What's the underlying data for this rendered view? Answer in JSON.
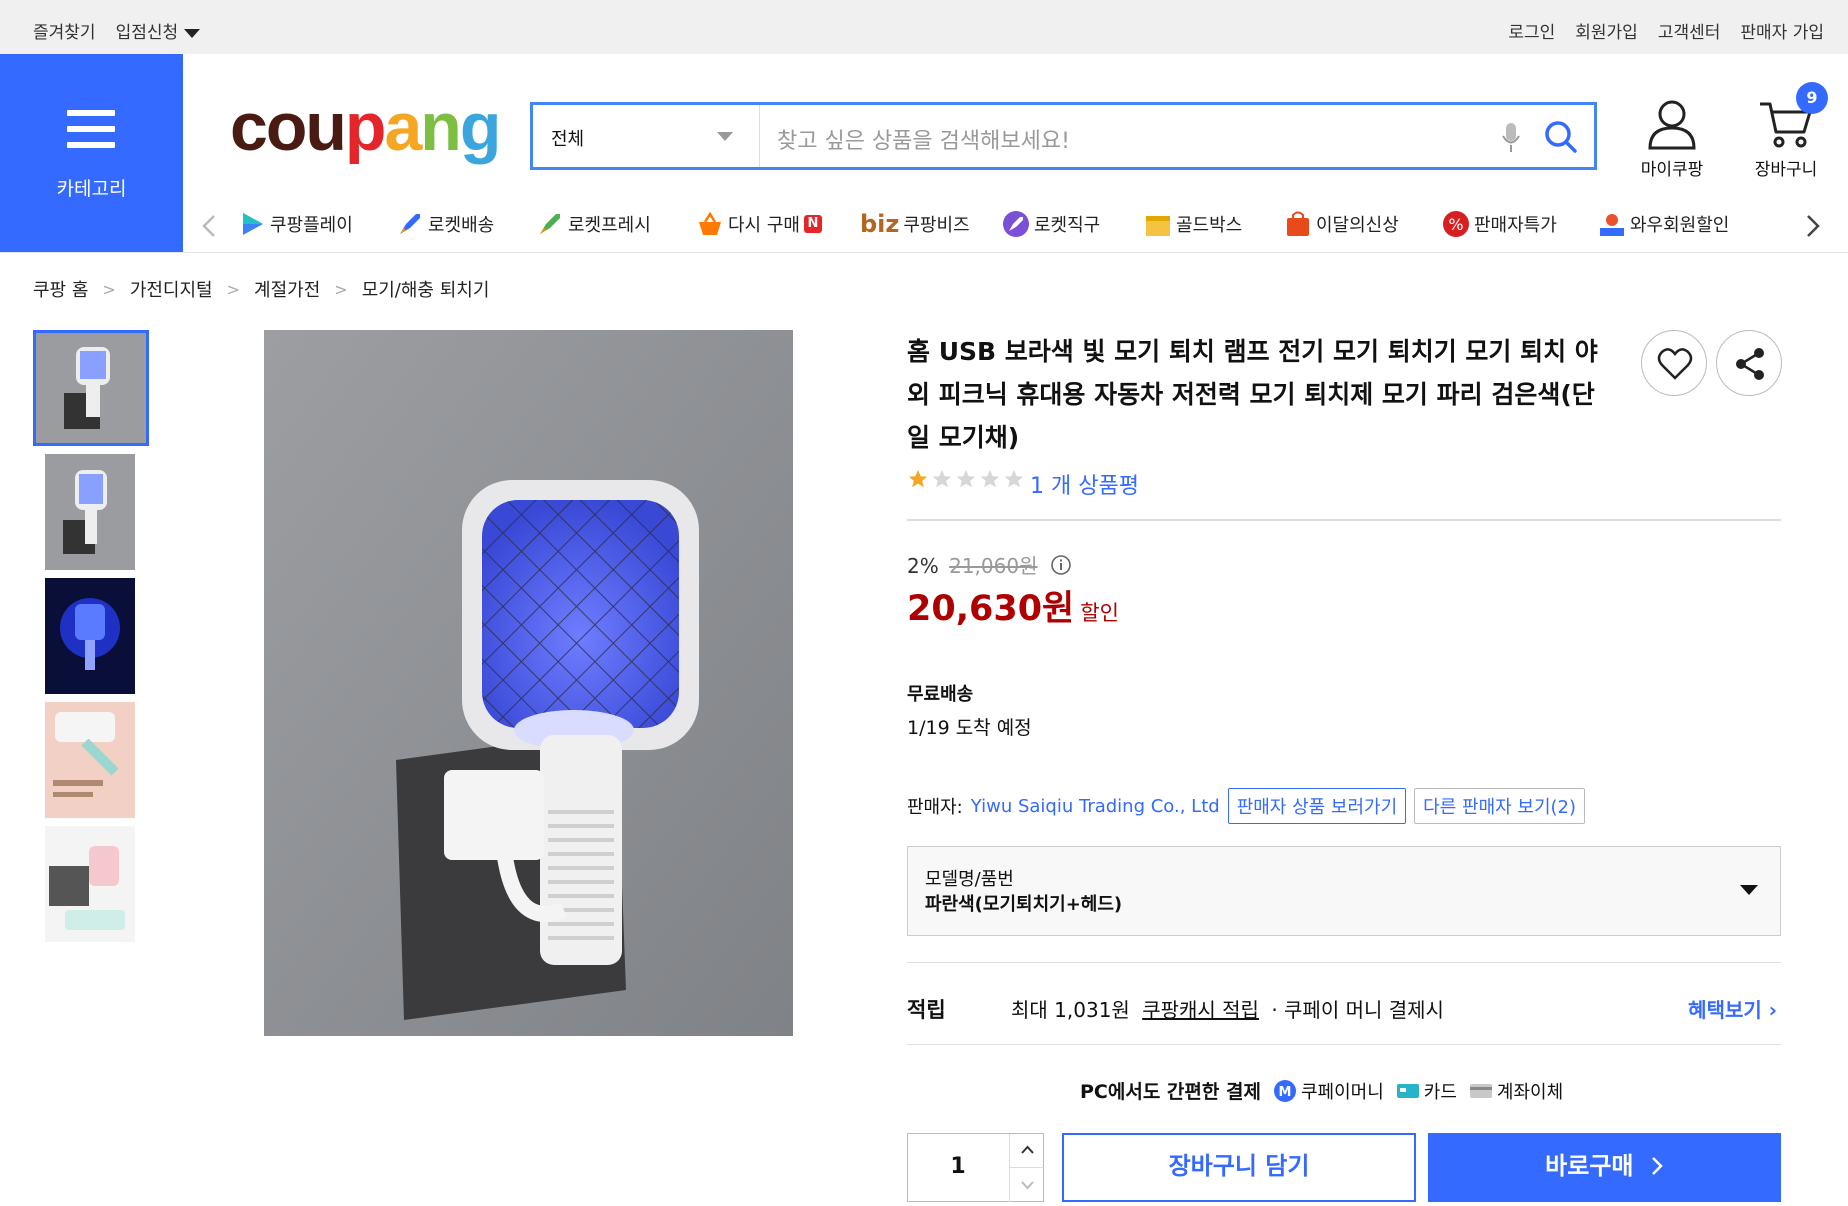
{
  "topbar": {
    "left": [
      "즐겨찾기",
      "입점신청"
    ],
    "right": [
      "로그인",
      "회원가입",
      "고객센터",
      "판매자 가입"
    ]
  },
  "header": {
    "category_label": "카테고리",
    "logo_text": "coupang",
    "search_scope": "전체",
    "search_placeholder": "찾고 싶은 상품을 검색해보세요!",
    "my_label": "마이쿠팡",
    "cart_label": "장바구니",
    "cart_count": "9"
  },
  "nav": [
    {
      "label": "쿠팡플레이",
      "icon": "play-icon"
    },
    {
      "label": "로켓배송",
      "icon": "rocket-icon"
    },
    {
      "label": "로켓프레시",
      "icon": "rocket-fresh-icon"
    },
    {
      "label": "다시 구매",
      "icon": "basket-icon",
      "badge": "N"
    },
    {
      "label": "쿠팡비즈",
      "icon": "biz-icon",
      "prefix": "biz"
    },
    {
      "label": "로켓직구",
      "icon": "rocket-global-icon"
    },
    {
      "label": "골드박스",
      "icon": "gold-box-icon"
    },
    {
      "label": "이달의신상",
      "icon": "new-bag-icon"
    },
    {
      "label": "판매자특가",
      "icon": "percent-icon"
    },
    {
      "label": "와우회원할인",
      "icon": "wow-icon"
    }
  ],
  "breadcrumb": [
    "쿠팡 홈",
    "가전디지털",
    "계절가전",
    "모기/해충 퇴치기"
  ],
  "product": {
    "title": "홈 USB 보라색 빛 모기 퇴치 램프 전기 모기 퇴치기 모기 퇴치 야외 피크닉 휴대용 자동차 저전력 모기 퇴치제 모기 파리 검은색(단일 모기채)",
    "rating": 1,
    "review_text": "1 개 상품평",
    "discount_rate": "2%",
    "original_price": "21,060원",
    "price": "20,630원",
    "price_tag": "할인",
    "shipping": "무료배송",
    "arrival": "1/19 도착 예정",
    "seller_label": "판매자:",
    "seller_name": "Yiwu Saiqiu Trading Co., Ltd",
    "seller_products_btn": "판매자 상품 보러가기",
    "other_sellers_btn": "다른 판매자 보기(2)",
    "option_label": "모델명/품번",
    "option_value": "파란색(모기퇴치기+헤드)",
    "reward_label": "적립",
    "reward_amount": "최대 1,031원",
    "reward_link": "쿠팡캐시 적립",
    "reward_cond": "· 쿠페이 머니 결제시",
    "reward_more": "혜택보기",
    "pay_title": "PC에서도 간편한 결제",
    "pay_methods": [
      "쿠페이머니",
      "카드",
      "계좌이체"
    ],
    "quantity": "1",
    "cart_button": "장바구니 담기",
    "buy_button": "바로구매"
  },
  "colors": {
    "accent": "#346aff",
    "price": "#ae0000"
  }
}
